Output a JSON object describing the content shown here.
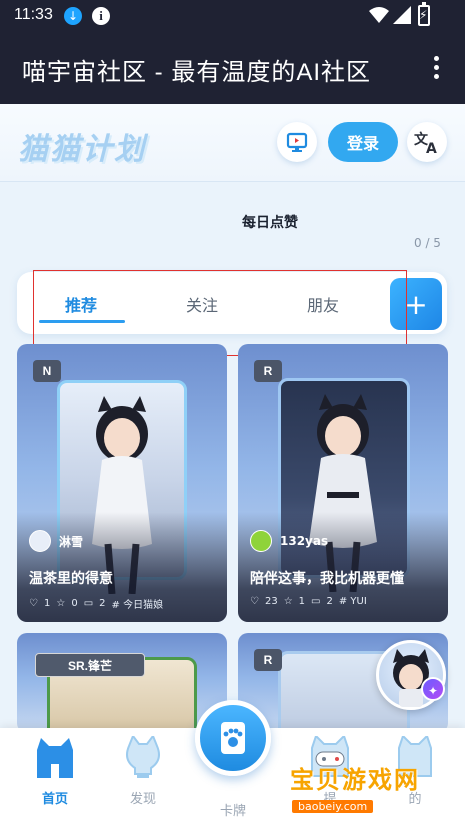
{
  "status_bar": {
    "time": "11:33"
  },
  "app_bar": {
    "title": "喵宇宙社区 - 最有温度的AI社区"
  },
  "header": {
    "logo_text": "猫猫计划",
    "login_label": "登录",
    "translate_icon": "translate-icon",
    "desktop_icon": "monitor-icon"
  },
  "daily": {
    "title": "每日点赞",
    "count": "0 / 5"
  },
  "tabs": [
    {
      "label": "推荐",
      "active": true
    },
    {
      "label": "关注",
      "active": false
    },
    {
      "label": "朋友",
      "active": false
    }
  ],
  "add_label": "+",
  "cards": [
    {
      "rarity": "N",
      "user": "淋雪",
      "title": "温茶里的得意",
      "likes": "1",
      "stars": "0",
      "comments": "2",
      "tag": "# 今日猫娘"
    },
    {
      "rarity": "R",
      "user": "132yas",
      "title": "陪伴这事，我比机器更懂",
      "likes": "23",
      "stars": "1",
      "comments": "2",
      "tag": "# YUI"
    },
    {
      "rarity": "SR.锋芒"
    },
    {
      "rarity": "R"
    }
  ],
  "bottom_nav": [
    {
      "label": "首页",
      "icon": "home-cat-icon",
      "active": true
    },
    {
      "label": "发现",
      "icon": "bulb-cat-icon",
      "active": false
    },
    {
      "label": "卡牌",
      "icon": "paw-card-icon",
      "active": false
    },
    {
      "label": "提",
      "icon": "game-cat-icon",
      "active": false
    },
    {
      "label": "的",
      "icon": "profile-cat-icon",
      "active": false
    }
  ],
  "watermark": {
    "main": "宝贝游戏网",
    "sub": "baobeiy.com"
  },
  "colors": {
    "accent": "#1f8be0",
    "appbar": "#1f2233"
  }
}
